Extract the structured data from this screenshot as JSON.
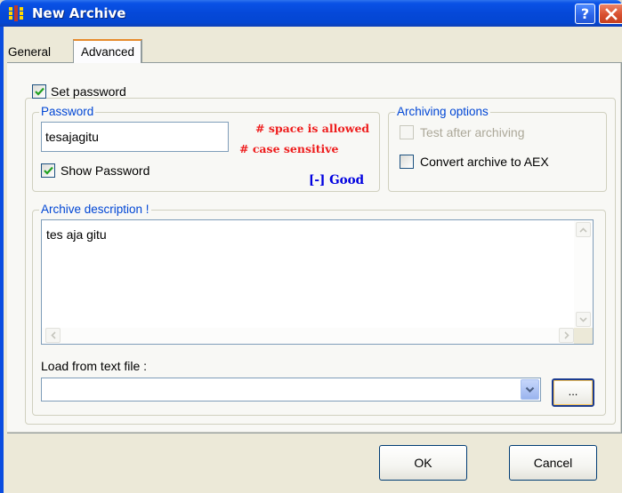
{
  "window": {
    "title": "New Archive",
    "help_label": "?",
    "close_label": "X"
  },
  "tabs": [
    {
      "label": "General",
      "active": false
    },
    {
      "label": "Advanced",
      "active": true
    }
  ],
  "password_section": {
    "set_password": {
      "label": "Set password",
      "checked": true
    },
    "group_label": "Password",
    "password_value": "tesajagitu",
    "hints": [
      "# space is allowed",
      "# case sensitive"
    ],
    "show_password": {
      "label": "Show Password",
      "checked": true
    },
    "strength": "[-] Good"
  },
  "archiving_options": {
    "group_label": "Archiving options",
    "test_after_archiving": {
      "label": "Test after archiving",
      "checked": false,
      "enabled": false
    },
    "convert_to_aex": {
      "label": "Convert archive to AEX",
      "checked": false,
      "enabled": true
    }
  },
  "description": {
    "group_label": "Archive description !",
    "text": "tes aja gitu",
    "load_label": "Load from text file :",
    "load_value": "",
    "browse_label": "..."
  },
  "buttons": {
    "ok": "OK",
    "cancel": "Cancel"
  },
  "colors": {
    "titlebar": "#0548d8",
    "group_label": "#0046d5",
    "hint": "#ee1c1c",
    "strength": "#0000e0",
    "active_tab_accent": "#e68b2c"
  },
  "icons": {
    "app": "archive-app-icon",
    "help": "help-icon",
    "close": "close-icon",
    "checkmark": "checkmark-icon",
    "dropdown": "chevron-down-icon"
  }
}
